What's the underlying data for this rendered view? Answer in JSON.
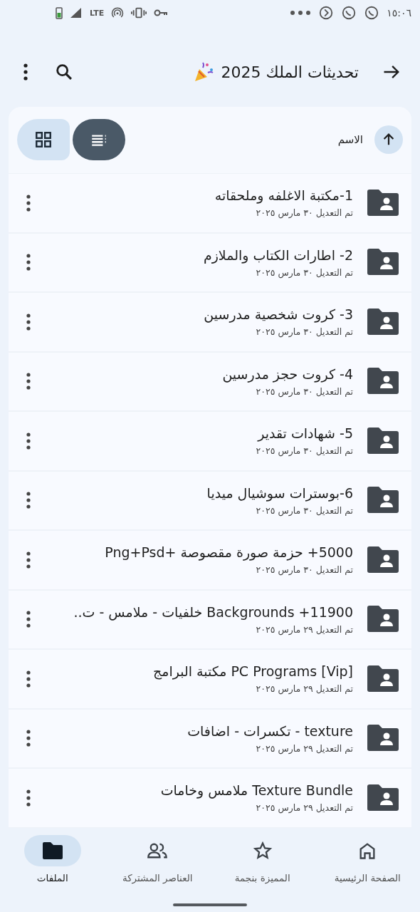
{
  "status_bar": {
    "time": "١٥:٠٦",
    "network": "LTE"
  },
  "app_bar": {
    "title": "تحديثات الملك 2025"
  },
  "toolbar": {
    "sort": {
      "label": "الاسم"
    },
    "view_toggle": [
      {
        "kind": "list",
        "selected": true
      },
      {
        "kind": "grid",
        "selected": false
      }
    ]
  },
  "files": [
    {
      "name": "1-مكتبة الاغلفه وملحقاته",
      "modified": "تم التعديل ٣٠ مارس ٢٠٢٥"
    },
    {
      "name": "2- اطارات الكتاب والملازم",
      "modified": "تم التعديل ٣٠ مارس ٢٠٢٥"
    },
    {
      "name": "3- كروت شخصية مدرسين",
      "modified": "تم التعديل ٣٠ مارس ٢٠٢٥"
    },
    {
      "name": "4- كروت حجز مدرسين",
      "modified": "تم التعديل ٣٠ مارس ٢٠٢٥"
    },
    {
      "name": "5- شهادات تقدير",
      "modified": "تم التعديل ٣٠ مارس ٢٠٢٥"
    },
    {
      "name": "6-بوسترات سوشيال ميديا",
      "modified": "تم التعديل ٣٠ مارس ٢٠٢٥"
    },
    {
      "name": "5000+ حزمة صورة مقصوصة +Png+Psd",
      "modified": "تم التعديل ٣٠ مارس ٢٠٢٥"
    },
    {
      "name": "11900+ Backgrounds خلفيات - ملامس - ت..",
      "modified": "تم التعديل ٢٩ مارس ٢٠٢٥"
    },
    {
      "name": "[PC Programs [Vip مكتبة البرامج",
      "modified": "تم التعديل ٢٩ مارس ٢٠٢٥"
    },
    {
      "name": "texture - تكسرات - اضافات",
      "modified": "تم التعديل ٢٩ مارس ٢٠٢٥"
    },
    {
      "name": "Texture Bundle ملامس وخامات",
      "modified": "تم التعديل ٢٩ مارس ٢٠٢٥"
    }
  ],
  "bottom_nav": [
    {
      "kind": "home",
      "label": "الصفحة الرئيسية",
      "selected": false
    },
    {
      "kind": "starred",
      "label": "المميزة بنجمة",
      "selected": false
    },
    {
      "kind": "shared",
      "label": "العناصر المشتركة",
      "selected": false
    },
    {
      "kind": "files",
      "label": "الملفات",
      "selected": true
    }
  ]
}
